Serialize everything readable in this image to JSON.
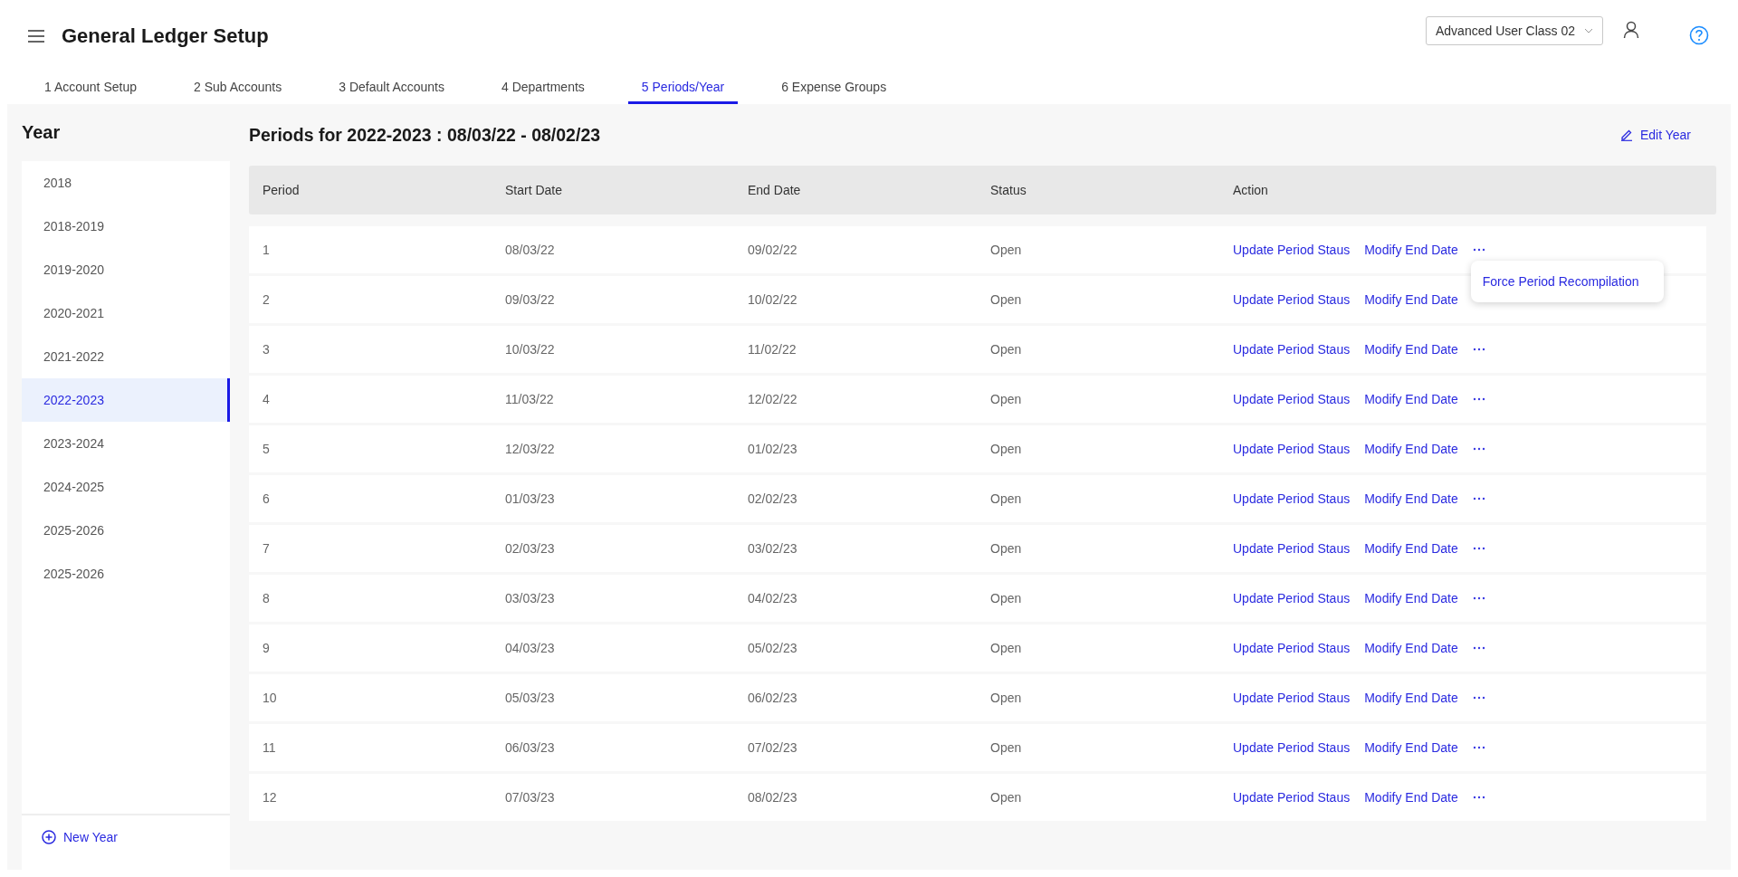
{
  "header": {
    "title": "General Ledger Setup",
    "role_select": {
      "value": "Advanced User Class 02"
    }
  },
  "tabs": [
    {
      "label": "1 Account Setup",
      "selected": false
    },
    {
      "label": "2 Sub Accounts",
      "selected": false
    },
    {
      "label": "3 Default Accounts",
      "selected": false
    },
    {
      "label": "4 Departments",
      "selected": false
    },
    {
      "label": "5 Periods/Year",
      "selected": true
    },
    {
      "label": "6 Expense Groups",
      "selected": false
    }
  ],
  "years": {
    "title": "Year",
    "items": [
      {
        "label": "2018",
        "selected": false
      },
      {
        "label": "2018-2019",
        "selected": false
      },
      {
        "label": "2019-2020",
        "selected": false
      },
      {
        "label": "2020-2021",
        "selected": false
      },
      {
        "label": "2021-2022",
        "selected": false
      },
      {
        "label": "2022-2023",
        "selected": true
      },
      {
        "label": "2023-2024",
        "selected": false
      },
      {
        "label": "2024-2025",
        "selected": false
      },
      {
        "label": "2025-2026",
        "selected": false
      },
      {
        "label": "2025-2026",
        "selected": false
      }
    ],
    "new_button": "New Year"
  },
  "periods": {
    "title": "Periods for 2022-2023 : 08/03/22 - 08/02/23",
    "edit_button": "Edit Year",
    "columns": [
      "Period",
      "Start Date",
      "End Date",
      "Status",
      "Action"
    ],
    "rows": [
      {
        "period": "1",
        "start": "08/03/22",
        "end": "09/02/22",
        "status": "Open",
        "actions": [
          "Update Period Staus",
          "Modify End Date"
        ],
        "menu": [
          "Force Period Recompilation"
        ]
      },
      {
        "period": "2",
        "start": "09/03/22",
        "end": "10/02/22",
        "status": "Open",
        "actions": [
          "Update Period Staus",
          "Modify End Date"
        ]
      },
      {
        "period": "3",
        "start": "10/03/22",
        "end": "11/02/22",
        "status": "Open",
        "actions": [
          "Update Period Staus",
          "Modify End Date"
        ]
      },
      {
        "period": "4",
        "start": "11/03/22",
        "end": "12/02/22",
        "status": "Open",
        "actions": [
          "Update Period Staus",
          "Modify End Date"
        ]
      },
      {
        "period": "5",
        "start": "12/03/22",
        "end": "01/02/23",
        "status": "Open",
        "actions": [
          "Update Period Staus",
          "Modify End Date"
        ]
      },
      {
        "period": "6",
        "start": "01/03/23",
        "end": "02/02/23",
        "status": "Open",
        "actions": [
          "Update Period Staus",
          "Modify End Date"
        ]
      },
      {
        "period": "7",
        "start": "02/03/23",
        "end": "03/02/23",
        "status": "Open",
        "actions": [
          "Update Period Staus",
          "Modify End Date"
        ]
      },
      {
        "period": "8",
        "start": "03/03/23",
        "end": "04/02/23",
        "status": "Open",
        "actions": [
          "Update Period Staus",
          "Modify End Date"
        ]
      },
      {
        "period": "9",
        "start": "04/03/23",
        "end": "05/02/23",
        "status": "Open",
        "actions": [
          "Update Period Staus",
          "Modify End Date"
        ]
      },
      {
        "period": "10",
        "start": "05/03/23",
        "end": "06/02/23",
        "status": "Open",
        "actions": [
          "Update Period Staus",
          "Modify End Date"
        ]
      },
      {
        "period": "11",
        "start": "06/03/23",
        "end": "07/02/23",
        "status": "Open",
        "actions": [
          "Update Period Staus",
          "Modify End Date"
        ]
      },
      {
        "period": "12",
        "start": "07/03/23",
        "end": "08/02/23",
        "status": "Open",
        "actions": [
          "Update Period Staus",
          "Modify End Date"
        ]
      }
    ]
  }
}
